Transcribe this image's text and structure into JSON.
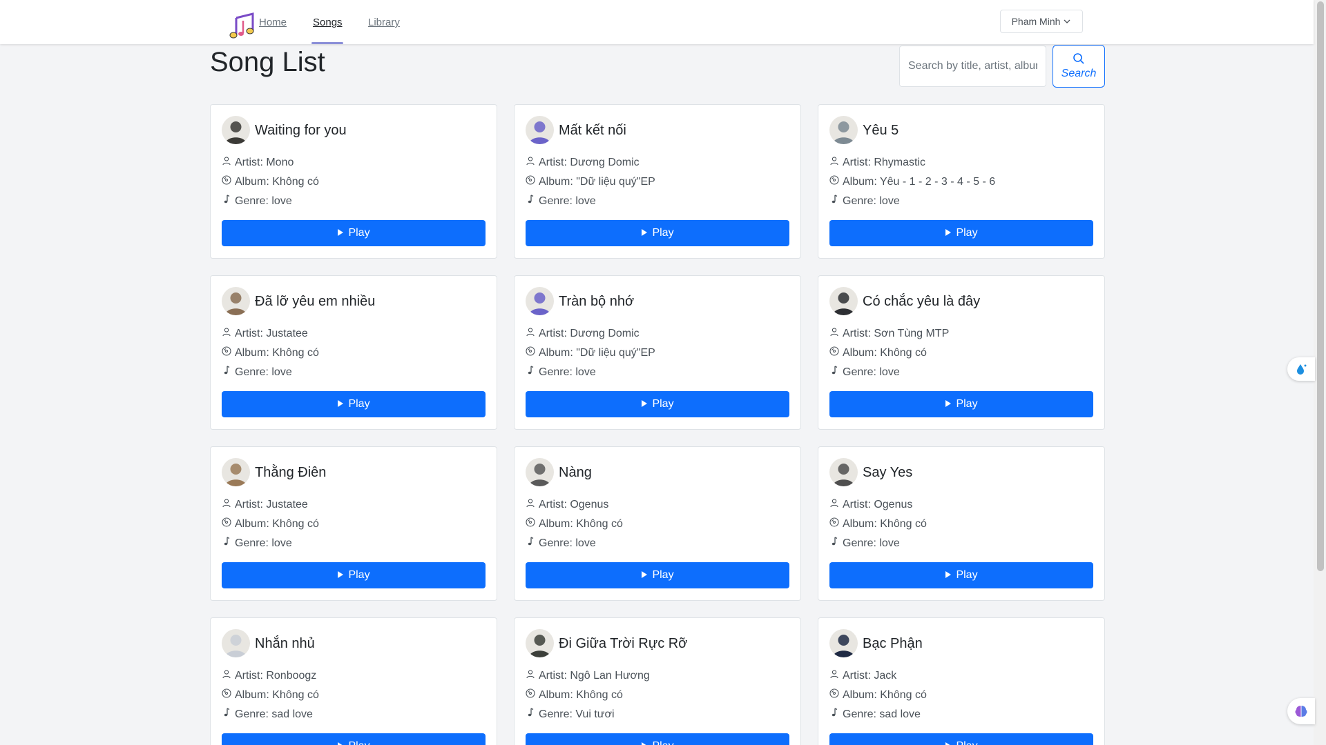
{
  "nav": {
    "home": "Home",
    "songs": "Songs",
    "library": "Library",
    "user": "Pham Minh"
  },
  "page": {
    "title": "Song List",
    "search_placeholder": "Search by title, artist, album",
    "search_label": "Search"
  },
  "labels": {
    "artist_prefix": "Artist: ",
    "album_prefix": "Album: ",
    "genre_prefix": "Genre: ",
    "play": "Play"
  },
  "songs": [
    {
      "title": "Waiting for you",
      "artist": "Artist: Mono",
      "album": "Album: Không có",
      "genre": "Genre: love",
      "avatar_color": "#3b3a36"
    },
    {
      "title": "Mất kết nối",
      "artist": "Artist: Dương Domic",
      "album": "Album: \"Dữ liệu quý\"EP",
      "genre": "Genre: love",
      "avatar_color": "#6b63c9"
    },
    {
      "title": "Yêu 5",
      "artist": "Artist: Rhymastic",
      "album": "Album: Yêu - 1 - 2 - 3 - 4 - 5 - 6",
      "genre": "Genre: love",
      "avatar_color": "#7d8a93"
    },
    {
      "title": "Đã lỡ yêu em nhiều",
      "artist": "Artist: Justatee",
      "album": "Album: Không có",
      "genre": "Genre: love",
      "avatar_color": "#8a6f55"
    },
    {
      "title": "Tràn bộ nhớ",
      "artist": "Artist: Dương Domic",
      "album": "Album: \"Dữ liệu quý\"EP",
      "genre": "Genre: love",
      "avatar_color": "#6b63c9"
    },
    {
      "title": "Có chắc yêu là đây",
      "artist": "Artist: Sơn Tùng MTP",
      "album": "Album: Không có",
      "genre": "Genre: love",
      "avatar_color": "#2d2f33"
    },
    {
      "title": "Thằng Điên",
      "artist": "Artist: Justatee",
      "album": "Album: Không có",
      "genre": "Genre: love",
      "avatar_color": "#9a7a58"
    },
    {
      "title": "Nàng",
      "artist": "Artist: Ogenus",
      "album": "Album: Không có",
      "genre": "Genre: love",
      "avatar_color": "#5a5a5a"
    },
    {
      "title": "Say Yes",
      "artist": "Artist: Ogenus",
      "album": "Album: Không có",
      "genre": "Genre: love",
      "avatar_color": "#4f4f4f"
    },
    {
      "title": "Nhắn nhủ",
      "artist": "Artist: Ronboogz",
      "album": "Album: Không có",
      "genre": "Genre: sad love",
      "avatar_color": "#c9ced6"
    },
    {
      "title": "Đi Giữa Trời Rực Rỡ",
      "artist": "Artist: Ngô Lan Hương",
      "album": "Album: Không có",
      "genre": "Genre: Vui tươi",
      "avatar_color": "#3c3f3a"
    },
    {
      "title": "Bạc Phận",
      "artist": "Artist: Jack",
      "album": "Album: Không có",
      "genre": "Genre: sad love",
      "avatar_color": "#1f2a44"
    }
  ],
  "colors": {
    "primary": "#0d6efd",
    "background": "#f3f4f6"
  },
  "icons": {
    "logo": "music-notes-icon",
    "artist": "person-icon",
    "album": "disc-icon",
    "genre": "music-note-icon",
    "play": "play-icon",
    "search": "search-icon"
  }
}
